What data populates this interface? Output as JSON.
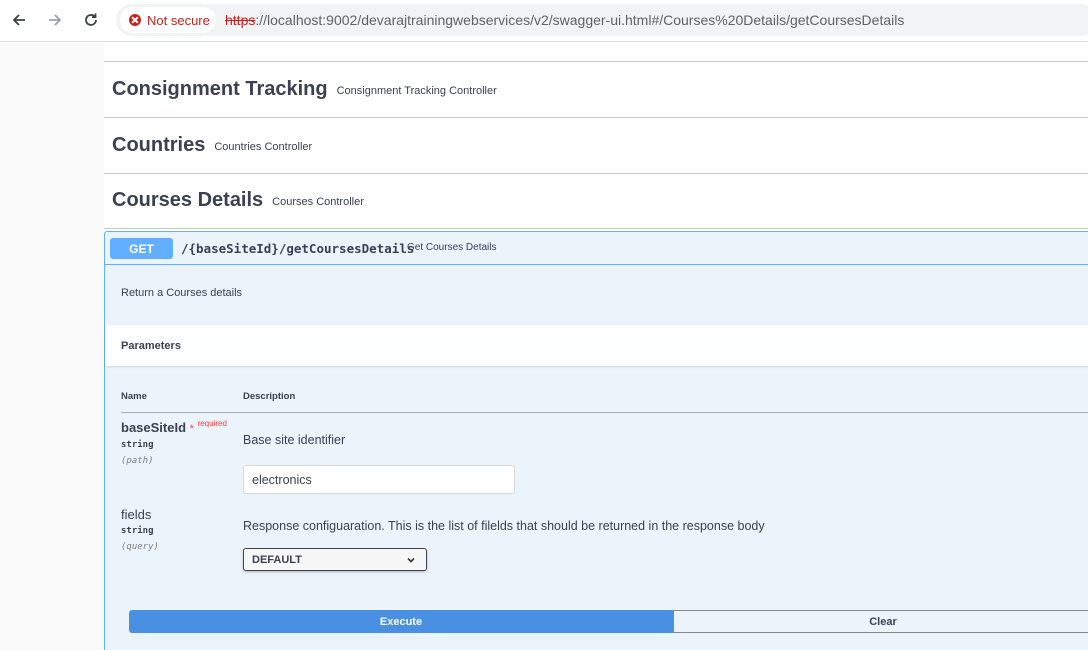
{
  "browser": {
    "security_label": "Not secure",
    "url_scheme": "https",
    "url_rest": "://localhost:9002/devarajtrainingwebservices/v2/swagger-ui.html#/Courses%20Details/getCoursesDetails"
  },
  "tags": [
    {
      "name": "Consignment Tracking",
      "description": "Consignment Tracking Controller"
    },
    {
      "name": "Countries",
      "description": "Countries Controller"
    },
    {
      "name": "Courses Details",
      "description": "Courses Controller"
    }
  ],
  "operation": {
    "method": "GET",
    "path": "/{baseSiteId}/getCoursesDetails",
    "summary": "Get Courses Details",
    "description": "Return a Courses details",
    "parameters_title": "Parameters",
    "col_name": "Name",
    "col_description": "Description",
    "params": [
      {
        "name": "baseSiteId",
        "required_star": "*",
        "required_label": "required",
        "type": "string",
        "in": "(path)",
        "description": "Base site identifier",
        "value": "electronics"
      },
      {
        "name": "fields",
        "type": "string",
        "in": "(query)",
        "description": "Response configuaration. This is the list of filelds that should be returned in the response body",
        "selected": "DEFAULT"
      }
    ],
    "execute_label": "Execute",
    "clear_label": "Clear"
  },
  "colors": {
    "get_method": "#61affe",
    "execute": "#4990e2",
    "required": "#f93e3e",
    "insecure": "#c5221f"
  }
}
